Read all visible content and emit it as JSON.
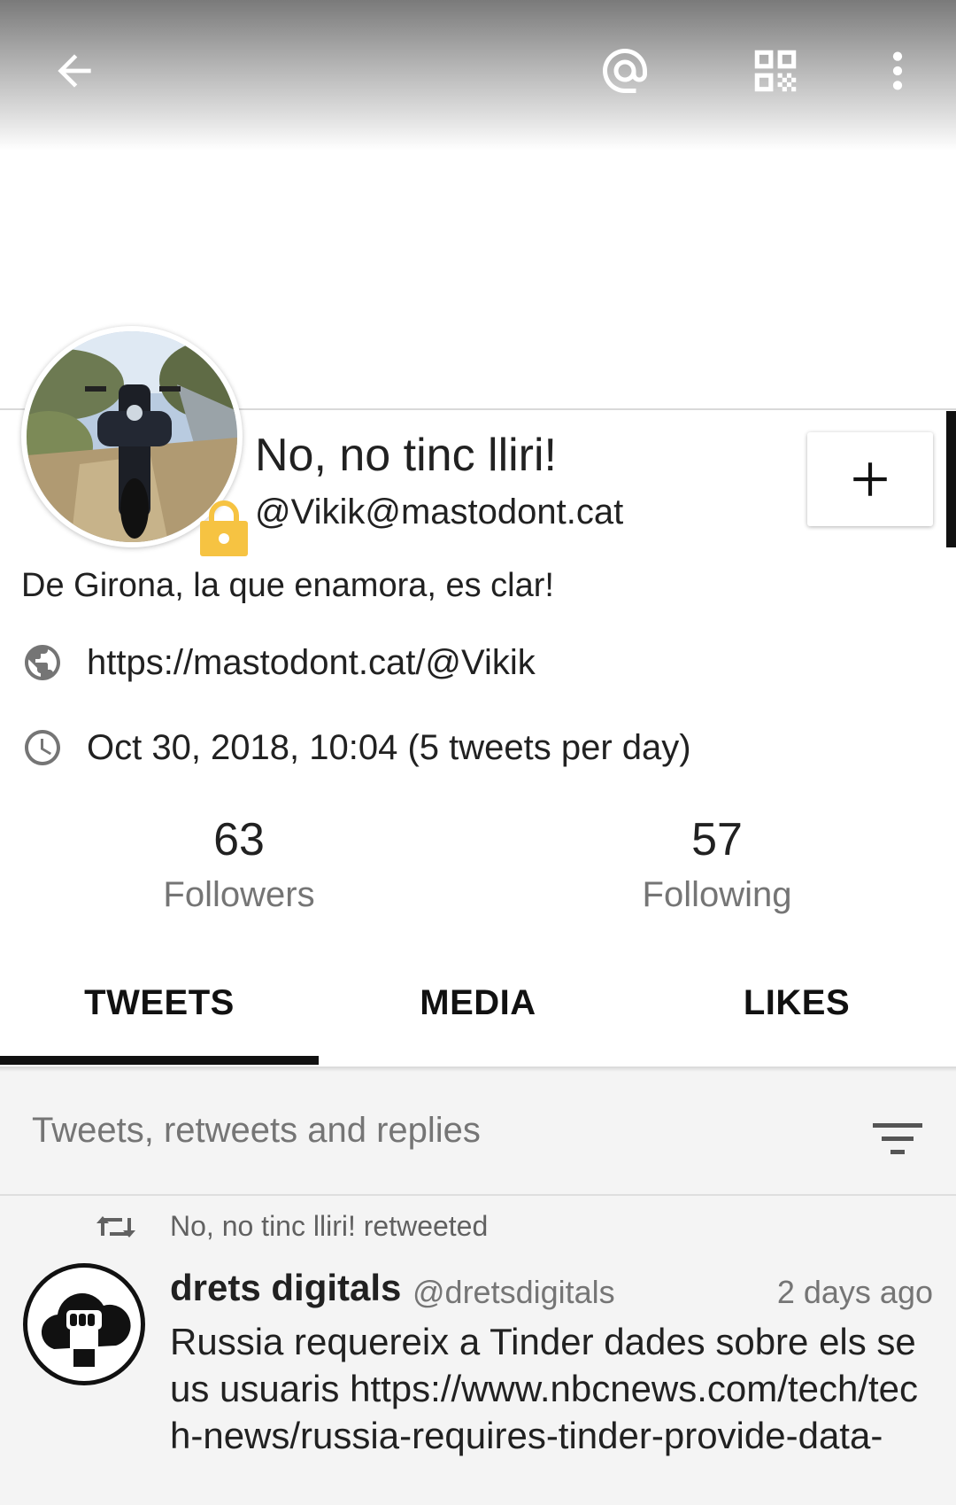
{
  "toolbar": {
    "back_icon": "arrow-left-icon",
    "mention_icon": "at-sign-icon",
    "qr_icon": "qr-code-icon",
    "more_icon": "more-vertical-icon"
  },
  "profile": {
    "name": "No, no tinc lliri!",
    "handle": "@Vikik@mastodont.cat",
    "locked": true,
    "bio": "De Girona, la que enamora, es clar!",
    "url": "https://mastodont.cat/@Vikik",
    "joined": "Oct 30, 2018, 10:04 (5 tweets per day)",
    "follow_button_icon": "plus-icon"
  },
  "stats": {
    "followers_count": "63",
    "followers_label": "Followers",
    "following_count": "57",
    "following_label": "Following"
  },
  "tabs": [
    {
      "label": "TWEETS",
      "active": true
    },
    {
      "label": "MEDIA",
      "active": false
    },
    {
      "label": "LIKES",
      "active": false
    }
  ],
  "filter": {
    "label": "Tweets, retweets and replies",
    "icon": "filter-icon"
  },
  "tweet": {
    "retweet_notice": "No, no tinc lliri! retweeted",
    "author_name": "drets digitals",
    "author_handle": "@dretsdigitals",
    "time": "2 days ago",
    "body": "Russia requereix a Tinder dades sobre els seus usuaris https://www.nbcnews.com/tech/tech-news/russia-requires-tinder-provide-data-"
  },
  "colors": {
    "lock": "#f6c342",
    "text": "#212121",
    "secondary": "#757575",
    "tab_indicator": "#111111"
  }
}
